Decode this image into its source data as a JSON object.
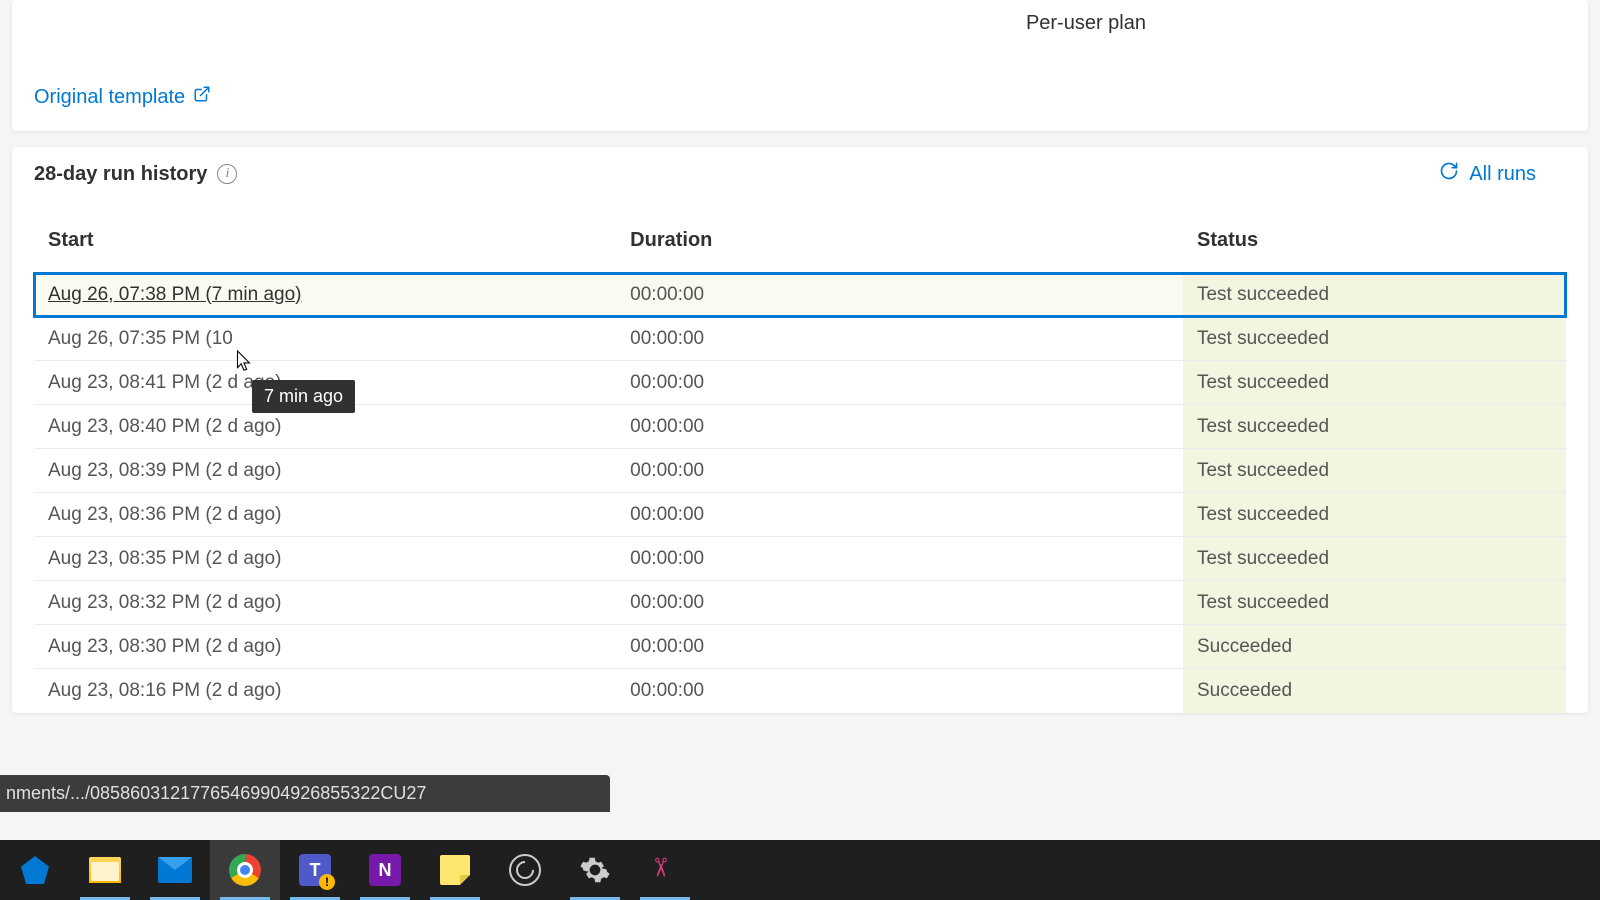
{
  "top": {
    "plan_label": "Per-user plan",
    "original_template_label": "Original template"
  },
  "history": {
    "title": "28-day run history",
    "all_runs_label": "All runs",
    "columns": {
      "start": "Start",
      "duration": "Duration",
      "status": "Status"
    },
    "tooltip_text": "7 min ago",
    "rows": [
      {
        "start": "Aug 26, 07:38 PM (7 min ago)",
        "duration": "00:00:00",
        "status": "Test succeeded",
        "selected": true
      },
      {
        "start": "Aug 26, 07:35 PM (10",
        "duration": "00:00:00",
        "status": "Test succeeded",
        "selected": false
      },
      {
        "start": "Aug 23, 08:41 PM (2 d ago)",
        "duration": "00:00:00",
        "status": "Test succeeded",
        "selected": false
      },
      {
        "start": "Aug 23, 08:40 PM (2 d ago)",
        "duration": "00:00:00",
        "status": "Test succeeded",
        "selected": false
      },
      {
        "start": "Aug 23, 08:39 PM (2 d ago)",
        "duration": "00:00:00",
        "status": "Test succeeded",
        "selected": false
      },
      {
        "start": "Aug 23, 08:36 PM (2 d ago)",
        "duration": "00:00:00",
        "status": "Test succeeded",
        "selected": false
      },
      {
        "start": "Aug 23, 08:35 PM (2 d ago)",
        "duration": "00:00:00",
        "status": "Test succeeded",
        "selected": false
      },
      {
        "start": "Aug 23, 08:32 PM (2 d ago)",
        "duration": "00:00:00",
        "status": "Test succeeded",
        "selected": false
      },
      {
        "start": "Aug 23, 08:30 PM (2 d ago)",
        "duration": "00:00:00",
        "status": "Succeeded",
        "selected": false
      },
      {
        "start": "Aug 23, 08:16 PM (2 d ago)",
        "duration": "00:00:00",
        "status": "Succeeded",
        "selected": false
      }
    ]
  },
  "status_bar_text": "nments/.../08586031217765469904926855322CU27",
  "taskbar": {
    "items": [
      {
        "name": "edge",
        "active": false,
        "pinned": false
      },
      {
        "name": "file-explorer",
        "active": false,
        "pinned": true
      },
      {
        "name": "mail",
        "active": false,
        "pinned": true
      },
      {
        "name": "chrome",
        "active": true,
        "pinned": true
      },
      {
        "name": "teams",
        "active": false,
        "pinned": true
      },
      {
        "name": "onenote",
        "active": false,
        "pinned": true
      },
      {
        "name": "sticky-notes",
        "active": false,
        "pinned": true
      },
      {
        "name": "obs",
        "active": false,
        "pinned": false
      },
      {
        "name": "settings",
        "active": false,
        "pinned": true
      },
      {
        "name": "snipping-tool",
        "active": false,
        "pinned": true
      }
    ]
  }
}
